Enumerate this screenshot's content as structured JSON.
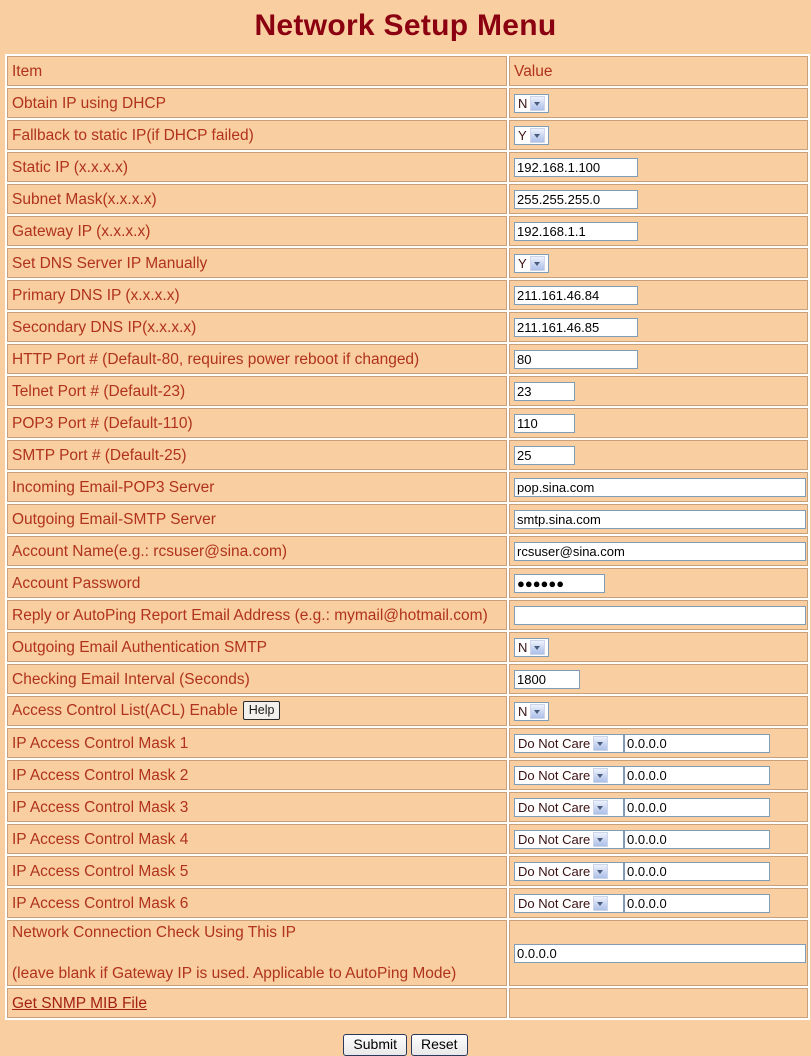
{
  "page": {
    "title": "Network Setup Menu",
    "title_color": "#8B0011",
    "background_color": "#F9CEA0",
    "label_color": "#B0321F"
  },
  "table": {
    "headers": {
      "item": "Item",
      "value": "Value"
    },
    "rows": [
      {
        "label": "Obtain IP using DHCP",
        "control": "select",
        "value": "N"
      },
      {
        "label": "Fallback to static IP(if DHCP failed)",
        "control": "select",
        "value": "Y"
      },
      {
        "label": "Static IP (x.x.x.x)",
        "control": "text",
        "value": "192.168.1.100"
      },
      {
        "label": "Subnet Mask(x.x.x.x)",
        "control": "text",
        "value": "255.255.255.0"
      },
      {
        "label": "Gateway IP (x.x.x.x)",
        "control": "text",
        "value": "192.168.1.1"
      },
      {
        "label": "Set DNS Server IP Manually",
        "control": "select",
        "value": "Y"
      },
      {
        "label": "Primary DNS IP (x.x.x.x)",
        "control": "text",
        "value": "211.161.46.84"
      },
      {
        "label": "Secondary DNS IP(x.x.x.x)",
        "control": "text",
        "value": "211.161.46.85"
      },
      {
        "label": "HTTP Port # (Default-80, requires power reboot if changed)",
        "control": "text",
        "value": "80"
      },
      {
        "label": "Telnet Port # (Default-23)",
        "control": "text",
        "value": "23"
      },
      {
        "label": "POP3 Port # (Default-110)",
        "control": "text",
        "value": "110"
      },
      {
        "label": "SMTP Port # (Default-25)",
        "control": "text",
        "value": "25"
      },
      {
        "label": "Incoming Email-POP3 Server",
        "control": "text",
        "value": "pop.sina.com"
      },
      {
        "label": "Outgoing Email-SMTP Server",
        "control": "text",
        "value": "smtp.sina.com"
      },
      {
        "label": "Account Name(e.g.: rcsuser@sina.com)",
        "control": "text",
        "value": "rcsuser@sina.com"
      },
      {
        "label": "Account Password",
        "control": "password",
        "value": "●●●●●●"
      },
      {
        "label": "Reply or AutoPing Report Email Address (e.g.: mymail@hotmail.com)",
        "control": "text",
        "value": ""
      },
      {
        "label": "Outgoing Email Authentication SMTP",
        "control": "select",
        "value": "N"
      },
      {
        "label": "Checking Email Interval (Seconds)",
        "control": "text",
        "value": "1800"
      }
    ],
    "acl_row": {
      "label": "Access Control List(ACL) Enable",
      "help_label": "Help",
      "value": "N"
    },
    "mask_rows": [
      {
        "label": "IP Access Control Mask 1",
        "mode": "Do Not Care",
        "value": "0.0.0.0"
      },
      {
        "label": "IP Access Control Mask 2",
        "mode": "Do Not Care",
        "value": "0.0.0.0"
      },
      {
        "label": "IP Access Control Mask 3",
        "mode": "Do Not Care",
        "value": "0.0.0.0"
      },
      {
        "label": "IP Access Control Mask 4",
        "mode": "Do Not Care",
        "value": "0.0.0.0"
      },
      {
        "label": "IP Access Control Mask 5",
        "mode": "Do Not Care",
        "value": "0.0.0.0"
      },
      {
        "label": "IP Access Control Mask 6",
        "mode": "Do Not Care",
        "value": "0.0.0.0"
      }
    ],
    "conn_check_row": {
      "label_line1": "Network Connection Check Using This IP",
      "label_line2": "(leave blank if Gateway IP is used. Applicable to AutoPing Mode)",
      "value": "0.0.0.0"
    },
    "snmp_row": {
      "label": "Get SNMP MIB File"
    }
  },
  "footer": {
    "submit_label": "Submit",
    "reset_label": "Reset"
  }
}
